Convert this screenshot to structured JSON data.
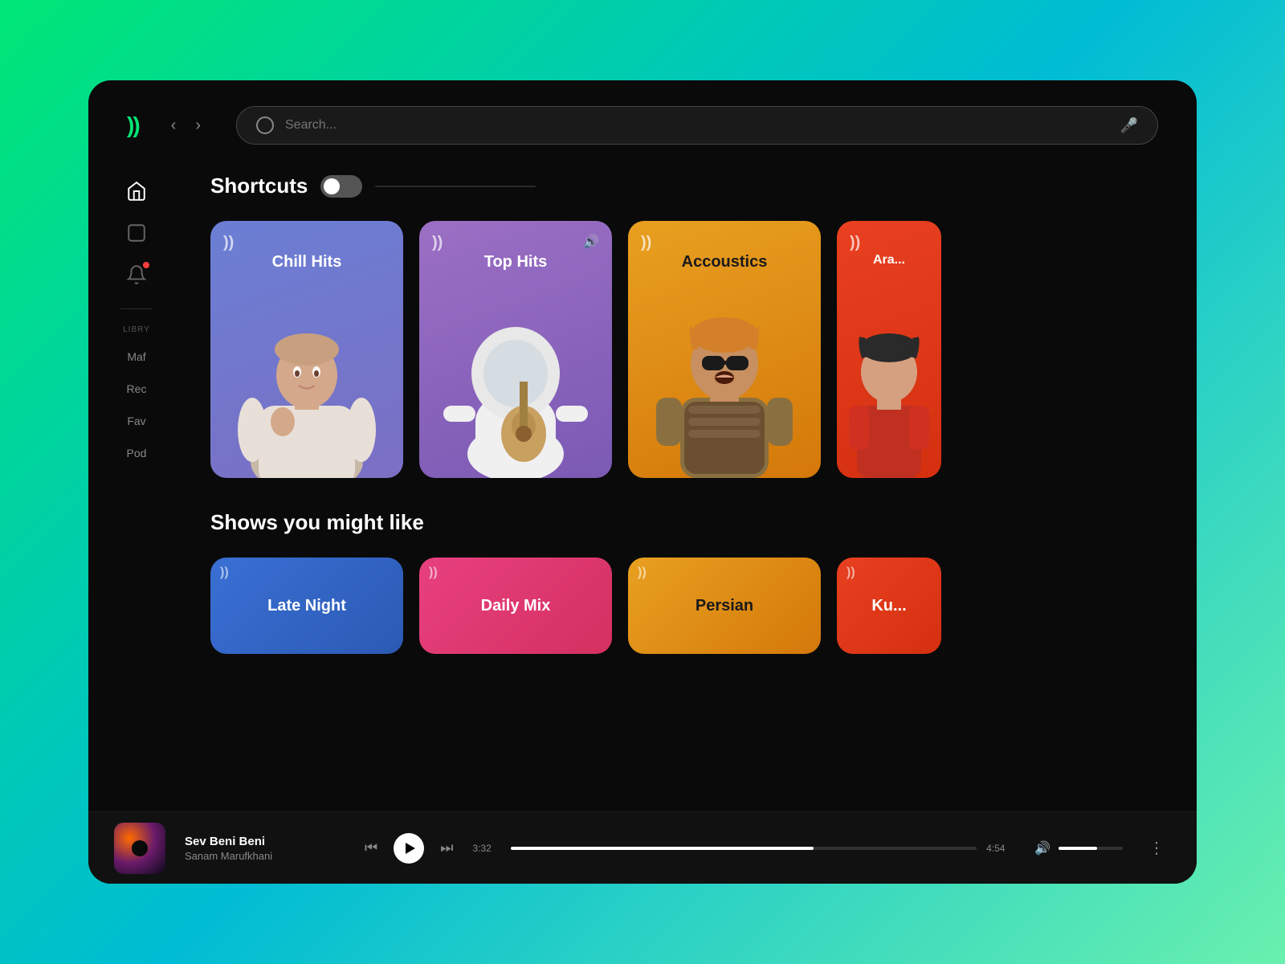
{
  "app": {
    "logo": "))",
    "background_gradient_start": "#00e676",
    "background_gradient_end": "#00bcd4"
  },
  "header": {
    "search_placeholder": "Search...",
    "nav_back": "‹",
    "nav_forward": "›"
  },
  "sidebar": {
    "icons": [
      "home",
      "playlist",
      "notifications"
    ],
    "library_label": "LIBRY",
    "library_items": [
      {
        "label": "Maf",
        "id": "maf"
      },
      {
        "label": "Rec",
        "id": "rec"
      },
      {
        "label": "Fav",
        "id": "fav"
      },
      {
        "label": "Pod",
        "id": "pod"
      }
    ]
  },
  "shortcuts": {
    "title": "Shortcuts",
    "cards": [
      {
        "id": "chill-hits",
        "title": "Chill Hits",
        "color_start": "#6a7fd4",
        "color_end": "#7b6fc4",
        "music_icon": "))"
      },
      {
        "id": "top-hits",
        "title": "Top Hits",
        "color_start": "#9b6fc4",
        "color_end": "#7b5ab4",
        "music_icon": "))",
        "is_playing": true
      },
      {
        "id": "accoustics",
        "title": "Accoustics",
        "color_start": "#e8a020",
        "color_end": "#d4780a",
        "music_icon": "))"
      },
      {
        "id": "arabic",
        "title": "Ara...",
        "color_start": "#e84020",
        "color_end": "#d43010",
        "music_icon": "))",
        "partial": true
      }
    ]
  },
  "shows_section": {
    "title": "Shows you might like",
    "cards": [
      {
        "id": "late-night",
        "title": "Late Night",
        "color_start": "#3a6fd4",
        "color_end": "#2b5ab4",
        "music_icon": "))"
      },
      {
        "id": "daily-mix",
        "title": "Daily Mix",
        "color_start": "#e84080",
        "color_end": "#d43060",
        "music_icon": "))"
      },
      {
        "id": "persian",
        "title": "Persian",
        "color_start": "#e8a020",
        "color_end": "#d4780a",
        "music_icon": "))"
      },
      {
        "id": "ku",
        "title": "Ku...",
        "color_start": "#e84020",
        "color_end": "#d43010",
        "music_icon": "))",
        "partial": true
      }
    ]
  },
  "player": {
    "track_name": "Sev Beni Beni",
    "artist": "Sanam Marufkhani",
    "current_time": "3:32",
    "total_time": "4:54",
    "progress_pct": 65,
    "volume_pct": 60,
    "controls": {
      "prev": "⏮",
      "play": "▶",
      "next": "⏭"
    }
  }
}
